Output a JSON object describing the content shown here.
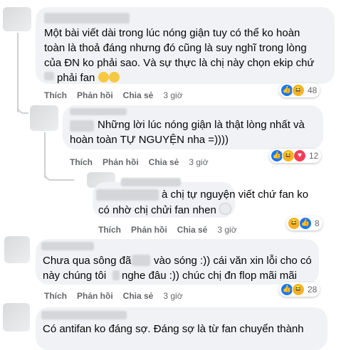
{
  "comments": [
    {
      "lines": [
        "Một bài viết dài trong lúc nóng giận tuy có thể ko hoàn",
        "toàn là thoả đáng nhưng đó cũng là suy nghĩ trong lòng",
        "của ĐN ko phải sao. Và sự thực là chị này chọn ekip chứ",
        "phải fan"
      ],
      "actions": {
        "like": "Thích",
        "reply": "Phản hồi",
        "share": "Chia sẻ",
        "time": "3 giờ"
      },
      "reaction_count": "48"
    },
    {
      "lines": [
        "Những lời lúc nóng giận là thật lòng nhất và",
        "hoàn toàn TỰ NGUYỆN nha =))))"
      ],
      "actions": {
        "like": "Thích",
        "reply": "Phản hồi",
        "share": "Chia sẻ",
        "time": "3 giờ"
      },
      "reaction_count": "12"
    },
    {
      "lines": [
        "à chị tự nguyện viết chứ fan ko",
        "có nhờ chị chửi fan nhen"
      ],
      "actions": {
        "like": "Thích",
        "reply": "Phản hồi",
        "share": "Chia sẻ",
        "time": "3 giờ"
      },
      "reaction_count": "8"
    },
    {
      "lines": [
        "Chưa qua sông đã",
        "vào sóng :)) cái văn xin lỗi cho có",
        "này chúng tôi",
        "nghe đâu :)) chúc chị đn flop mãi mãi"
      ],
      "actions": {
        "like": "Thích",
        "reply": "Phản hồi",
        "share": "Chia sẻ",
        "time": "3 giờ"
      },
      "reaction_count": "28"
    },
    {
      "lines": [
        "Có antifan ko đáng sợ. Đáng sợ là từ fan chuyển thành"
      ]
    }
  ]
}
